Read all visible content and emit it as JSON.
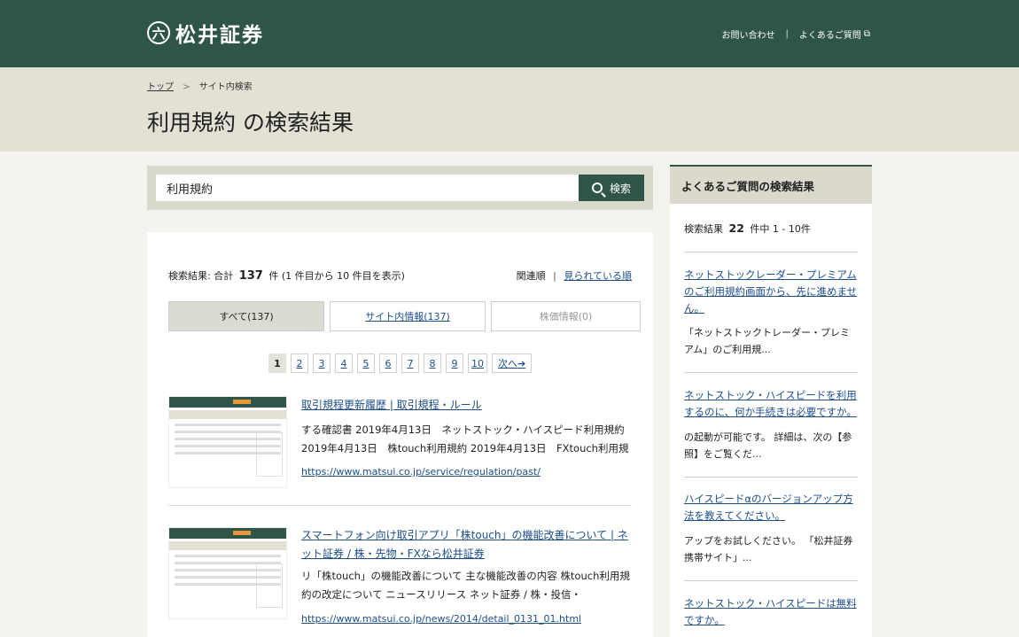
{
  "header": {
    "logo_mark": "六",
    "logo_text": "松井証券",
    "contact": "お問い合わせ",
    "separator": "|",
    "faq": "よくあるご質問"
  },
  "breadcrumb": {
    "top": "トップ",
    "arrow": ">",
    "current": "サイト内検索"
  },
  "page_title": "利用規約 の検索結果",
  "search": {
    "value": "利用規約",
    "button": "検索"
  },
  "results": {
    "summary_prefix": "検索結果:  合計",
    "total": "137",
    "summary_suffix": "件 (1 件目から 10 件目を表示)",
    "sort_relevance": "関連順",
    "sort_sep": "|",
    "sort_popular": "見られている順",
    "tabs": [
      "すべて(137)",
      "サイト内情報(137)",
      "株価情報(0)"
    ],
    "pages": [
      "1",
      "2",
      "3",
      "4",
      "5",
      "6",
      "7",
      "8",
      "9",
      "10"
    ],
    "next": "次へ➔",
    "items": [
      {
        "title": "取引規程更新履歴 | 取引規程・ルール",
        "snippet": "する確認書 2019年4月13日　ネットストック・ハイスピード利用規約 2019年4月13日　株touch利用規約 2019年4月13日　FXtouch利用規",
        "url": "https://www.matsui.co.jp/service/regulation/past/"
      },
      {
        "title": "スマートフォン向け取引アプリ「株touch」の機能改善について | ネット証券 / 株・先物・FXなら松井証券",
        "snippet": "リ「株touch」の機能改善について 主な機能改善の内容 株touch利用規約の改定について ニュースリリース ネット証券 / 株・投信・",
        "url": "https://www.matsui.co.jp/news/2014/detail_0131_01.html"
      }
    ]
  },
  "sidebar": {
    "title": "よくあるご質問の検索結果",
    "count_prefix": "検索結果",
    "count": "22",
    "count_suffix": "件中 1 - 10件",
    "faqs": [
      {
        "title": "ネットストックレーダー・プレミアムのご利用規約画面から、先に進めません。",
        "snippet": "「ネットストックトレーダー・プレミアム」のご利用規..."
      },
      {
        "title": "ネットストック・ハイスピードを利用するのに、何か手続きは必要ですか。",
        "snippet": "の起動が可能です。 詳細は、次の【参照】をご覧くだ..."
      },
      {
        "title": "ハイスピードαのバージョンアップ方法を教えてください。",
        "snippet": "アップをお試しください。 「松井証券携帯サイト」..."
      },
      {
        "title": "ネットストック・ハイスピードは無料ですか。",
        "snippet": ""
      }
    ]
  }
}
